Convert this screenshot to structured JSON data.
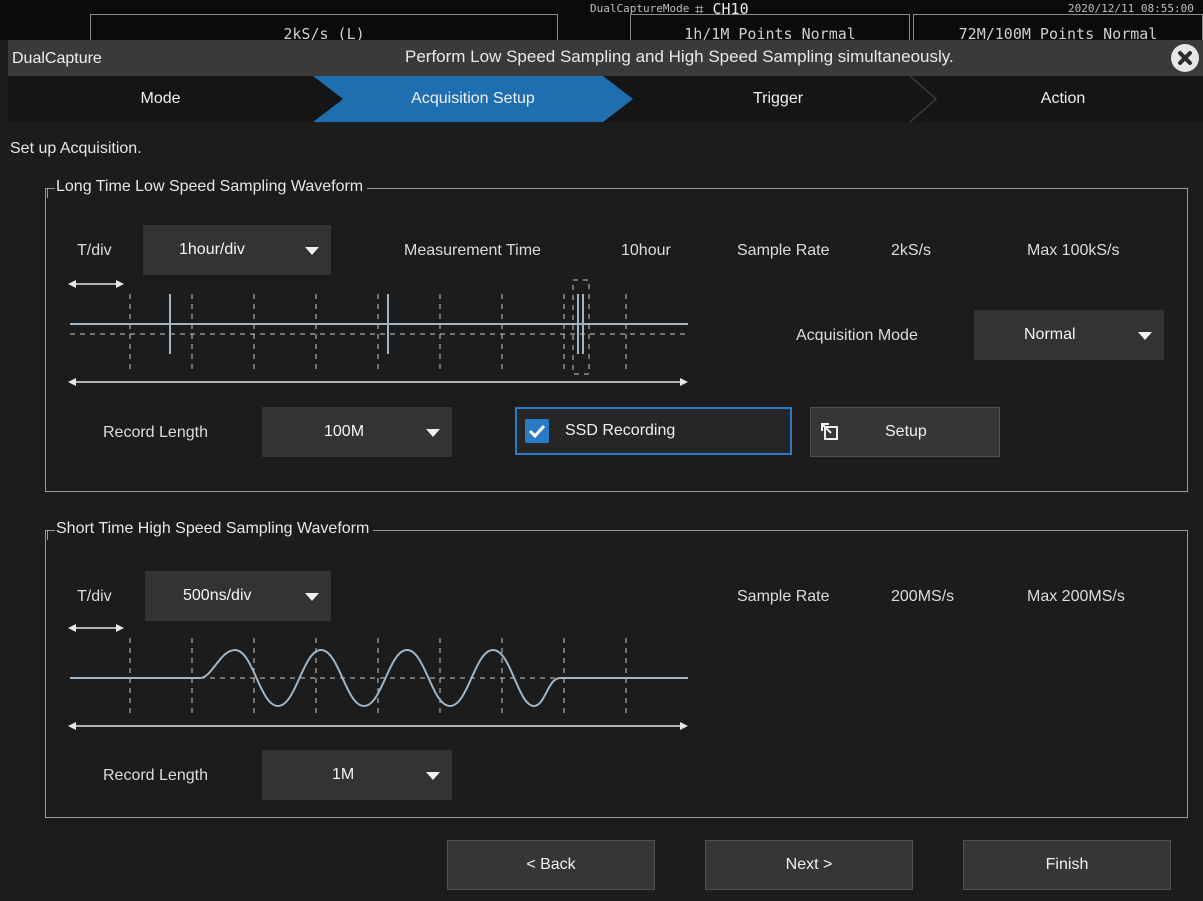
{
  "status_bar": {
    "mode": "DualCaptureMode",
    "channel": "CH10",
    "datetime": "2020/12/11 08:55:00",
    "box1_text": "2kS/s (L)",
    "box2_text": "1h/1M Points Normal",
    "box3_text": "72M/100M Points Normal"
  },
  "title_bar": {
    "name": "DualCapture",
    "description": "Perform Low Speed Sampling and High Speed Sampling simultaneously."
  },
  "steps": [
    {
      "label": "Mode",
      "active": false
    },
    {
      "label": "Acquisition Setup",
      "active": true
    },
    {
      "label": "Trigger",
      "active": false
    },
    {
      "label": "Action",
      "active": false
    }
  ],
  "instruction": "Set up Acquisition.",
  "low_speed": {
    "title": "Long Time Low Speed Sampling Waveform",
    "tdiv_label": "T/div",
    "tdiv_value": "1hour/div",
    "measurement_time_label": "Measurement Time",
    "measurement_time_value": "10hour",
    "sample_rate_label": "Sample Rate",
    "sample_rate_value": "2kS/s",
    "max_rate": "Max 100kS/s",
    "acquisition_mode_label": "Acquisition Mode",
    "acquisition_mode_value": "Normal",
    "record_length_label": "Record Length",
    "record_length_value": "100M",
    "ssd_recording_label": "SSD Recording",
    "ssd_recording_checked": true,
    "setup_label": "Setup"
  },
  "high_speed": {
    "title": "Short Time High Speed Sampling Waveform",
    "tdiv_label": "T/div",
    "tdiv_value": "500ns/div",
    "sample_rate_label": "Sample Rate",
    "sample_rate_value": "200MS/s",
    "max_rate": "Max 200MS/s",
    "record_length_label": "Record Length",
    "record_length_value": "1M"
  },
  "footer": {
    "back_label": "< Back",
    "next_label": "Next >",
    "finish_label": "Finish"
  },
  "colors": {
    "accent": "#1f6fb0",
    "checkbox": "#2a7bc6",
    "background": "#1c1c1c",
    "waveform": "#9fb6c8"
  }
}
